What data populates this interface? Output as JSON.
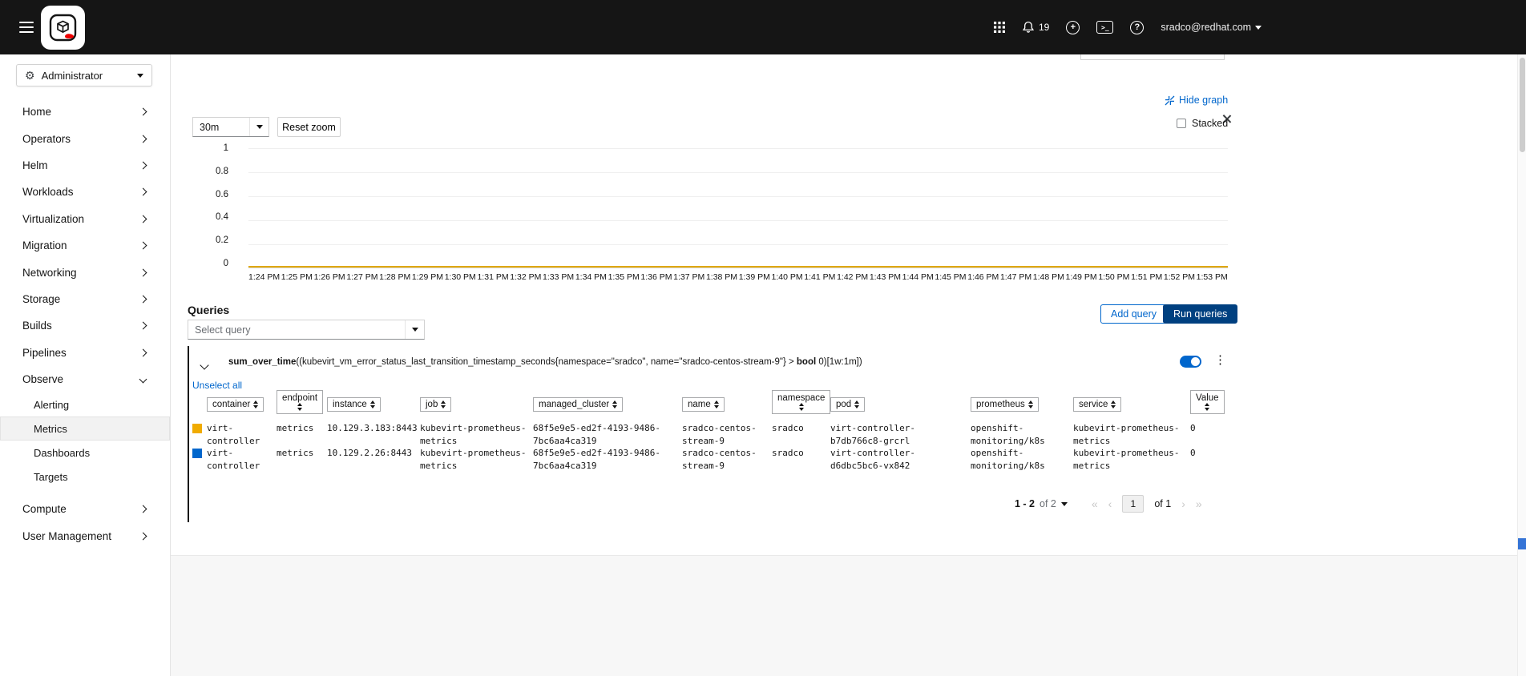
{
  "glyphs": {
    "gear": "⚙",
    "kebab": "⋮",
    "help": "?",
    "plus": "+",
    "terminal": ">_"
  },
  "masthead": {
    "notification_count": "19",
    "user_email": "sradco@redhat.com"
  },
  "sidebar": {
    "perspective_label": "Administrator",
    "items": [
      "Home",
      "Operators",
      "Helm",
      "Workloads",
      "Virtualization",
      "Migration",
      "Networking",
      "Storage",
      "Builds",
      "Pipelines"
    ],
    "observe_label": "Observe",
    "observe_children": [
      "Alerting",
      "Metrics",
      "Dashboards",
      "Targets"
    ],
    "bottom_items": [
      "Compute",
      "User Management"
    ]
  },
  "graph_panel": {
    "hide_graph_label": "Hide graph",
    "stacked_label": "Stacked",
    "time_range_value": "30m",
    "reset_zoom_label": "Reset zoom"
  },
  "chart_data": {
    "type": "line",
    "title": "",
    "ylabel": "",
    "xlabel": "",
    "ylim": [
      0,
      1
    ],
    "grid": true,
    "legend_position": "none",
    "y_ticks": [
      "1",
      "0.8",
      "0.6",
      "0.4",
      "0.2",
      "0"
    ],
    "x_labels": [
      "1:24 PM",
      "1:25 PM",
      "1:26 PM",
      "1:27 PM",
      "1:28 PM",
      "1:29 PM",
      "1:30 PM",
      "1:31 PM",
      "1:32 PM",
      "1:33 PM",
      "1:34 PM",
      "1:35 PM",
      "1:36 PM",
      "1:37 PM",
      "1:38 PM",
      "1:39 PM",
      "1:40 PM",
      "1:41 PM",
      "1:42 PM",
      "1:43 PM",
      "1:44 PM",
      "1:45 PM",
      "1:46 PM",
      "1:47 PM",
      "1:48 PM",
      "1:49 PM",
      "1:50 PM",
      "1:51 PM",
      "1:52 PM",
      "1:53 PM"
    ],
    "series": [
      {
        "name": "virt-controller 10.129.3.183:8443",
        "color": "#e0a800",
        "values": [
          0,
          0,
          0,
          0,
          0,
          0,
          0,
          0,
          0,
          0,
          0,
          0,
          0,
          0,
          0,
          0,
          0,
          0,
          0,
          0,
          0,
          0,
          0,
          0,
          0,
          0,
          0,
          0,
          0,
          0
        ]
      },
      {
        "name": "virt-controller 10.129.2.26:8443",
        "color": "#0066cc",
        "values": [
          0,
          0,
          0,
          0,
          0,
          0,
          0,
          0,
          0,
          0,
          0,
          0,
          0,
          0,
          0,
          0,
          0,
          0,
          0,
          0,
          0,
          0,
          0,
          0,
          0,
          0,
          0,
          0,
          0,
          0
        ]
      }
    ]
  },
  "queries": {
    "section_title": "Queries",
    "select_placeholder": "Select query",
    "add_query_label": "Add query",
    "run_queries_label": "Run queries",
    "unselect_all_label": "Unselect all",
    "expression": {
      "fn_bold": "sum_over_time",
      "body": "((kubevirt_vm_error_status_last_transition_timestamp_seconds{namespace=\"sradco\", name=\"sradco-centos-stream-9\"} > ",
      "operator_bold": "bool",
      "tail": " 0)[1w:1m])"
    }
  },
  "results_table": {
    "columns": [
      "container",
      "endpoint",
      "instance",
      "job",
      "managed_cluster",
      "name",
      "namespace",
      "pod",
      "prometheus",
      "service",
      "Value"
    ],
    "rows": [
      {
        "series_color": "#f0ab00",
        "container": "virt-controller",
        "endpoint": "metrics",
        "instance": "10.129.3.183:8443",
        "job": "kubevirt-prometheus-metrics",
        "managed_cluster": "68f5e9e5-ed2f-4193-9486-7bc6aa4ca319",
        "name": "sradco-centos-stream-9",
        "namespace": "sradco",
        "pod": "virt-controller-b7db766c8-grcrl",
        "prometheus": "openshift-monitoring/k8s",
        "service": "kubevirt-prometheus-metrics",
        "value": "0"
      },
      {
        "series_color": "#0066cc",
        "container": "virt-controller",
        "endpoint": "metrics",
        "instance": "10.129.2.26:8443",
        "job": "kubevirt-prometheus-metrics",
        "managed_cluster": "68f5e9e5-ed2f-4193-9486-7bc6aa4ca319",
        "name": "sradco-centos-stream-9",
        "namespace": "sradco",
        "pod": "virt-controller-d6dbc5bc6-vx842",
        "prometheus": "openshift-monitoring/k8s",
        "service": "kubevirt-prometheus-metrics",
        "value": "0"
      }
    ]
  },
  "pagination": {
    "range_bold": "1 - 2",
    "range_rest": "of 2",
    "current_page": "1",
    "of_pages": "of 1",
    "nav_glyphs": {
      "first": "«",
      "prev": "‹",
      "next": "›",
      "last": "»"
    }
  }
}
